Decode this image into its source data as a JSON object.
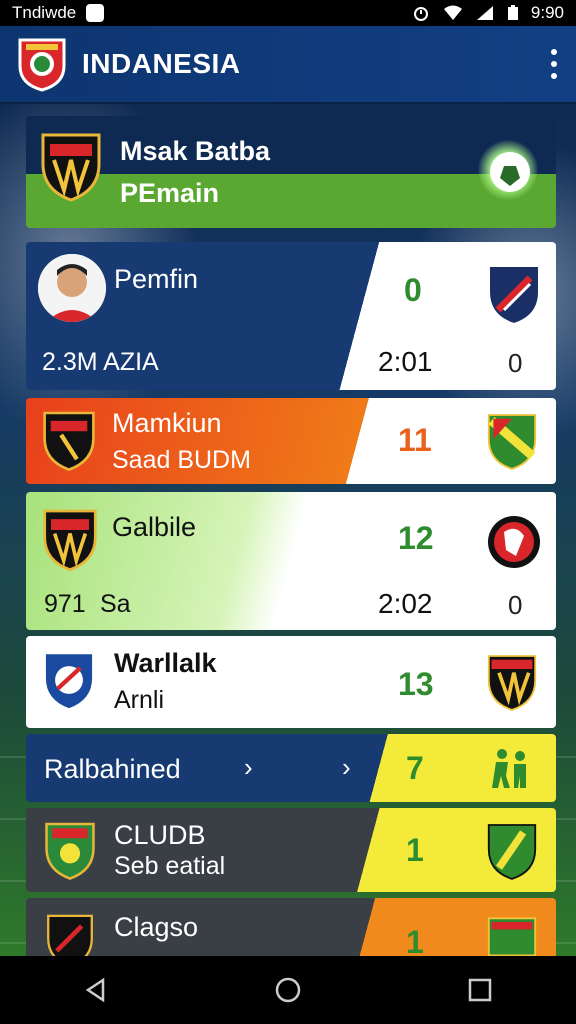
{
  "status_bar": {
    "carrier": "Tndiwde",
    "time": "9:90"
  },
  "app_bar": {
    "title": "INDANESIA"
  },
  "colors": {
    "app_bar": "#123f84",
    "green": "#5aa832",
    "orange": "#f06b1a",
    "yellow": "#f3ea3a",
    "score_green": "#2e8b2e"
  },
  "header_card": {
    "title": "Msak Batba",
    "subtitle": "PEmain",
    "icon": "soccer-ball-icon"
  },
  "matches": [
    {
      "name": "Pemfin",
      "sub": "2.3M AZIA",
      "score": "0",
      "time": "2:01",
      "extra": "0"
    },
    {
      "name": "Mamkiun",
      "sub": "Saad BUDM",
      "score": "11"
    },
    {
      "name": "Galbile",
      "sub": "Sa",
      "num": "971",
      "score": "12",
      "time": "2:02",
      "extra": "0"
    },
    {
      "name": "Warllalk",
      "sub": "Arnli",
      "score": "13"
    }
  ],
  "section": {
    "label": "Ralbahined",
    "value": "7",
    "icon": "players-icon"
  },
  "clubs": [
    {
      "name": "CLUDB",
      "sub": "Seb eatial",
      "score": "1"
    },
    {
      "name": "Clagso",
      "score": "1"
    }
  ]
}
